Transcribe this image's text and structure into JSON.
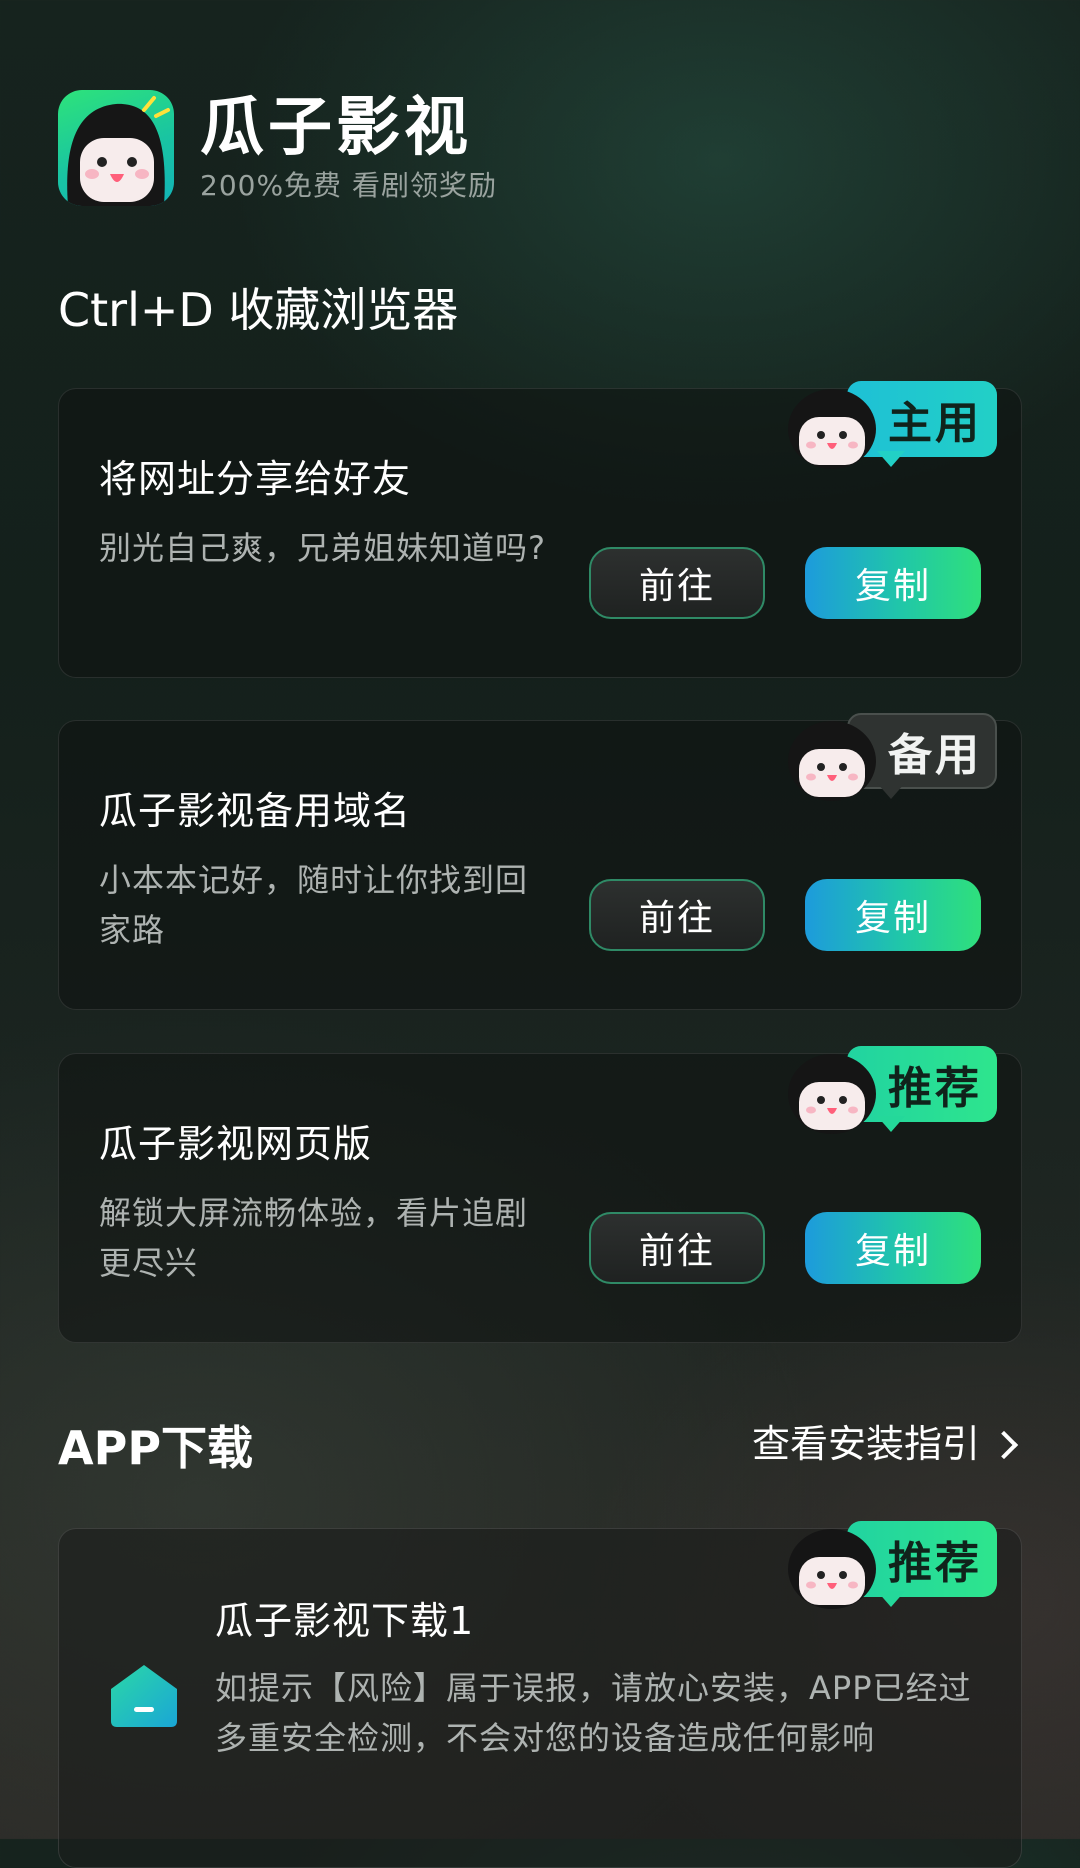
{
  "header": {
    "app_name": "瓜子影视",
    "slogan": "200%免费 看剧领奖励"
  },
  "bookmark_section": {
    "title": "Ctrl+D 收藏浏览器"
  },
  "link_cards": [
    {
      "badge": "主用",
      "title": "将网址分享给好友",
      "description": "别光自己爽，兄弟姐妹知道吗?",
      "go_label": "前往",
      "copy_label": "复制"
    },
    {
      "badge": "备用",
      "title": "瓜子影视备用域名",
      "description": "小本本记好，随时让你找到回家路",
      "go_label": "前往",
      "copy_label": "复制"
    },
    {
      "badge": "推荐",
      "title": "瓜子影视网页版",
      "description": "解锁大屏流畅体验，看片追剧更尽兴",
      "go_label": "前往",
      "copy_label": "复制"
    }
  ],
  "download_section": {
    "title": "APP下载",
    "guide_link": "查看安装指引",
    "card": {
      "badge": "推荐",
      "title": "瓜子影视下载1",
      "description": "如提示【风险】属于误报，请放心安装，APP已经过多重安全检测，不会对您的设备造成任何影响"
    }
  },
  "colors": {
    "accent_green": "#2ee58d",
    "accent_blue": "#1d9bdc",
    "background": "#16231e"
  },
  "icons": {
    "logo": "mascot-logo-icon",
    "badge_mascot": "mascot-icon",
    "guide_chevron": "chevron-right-icon",
    "download_app": "android-app-icon"
  }
}
